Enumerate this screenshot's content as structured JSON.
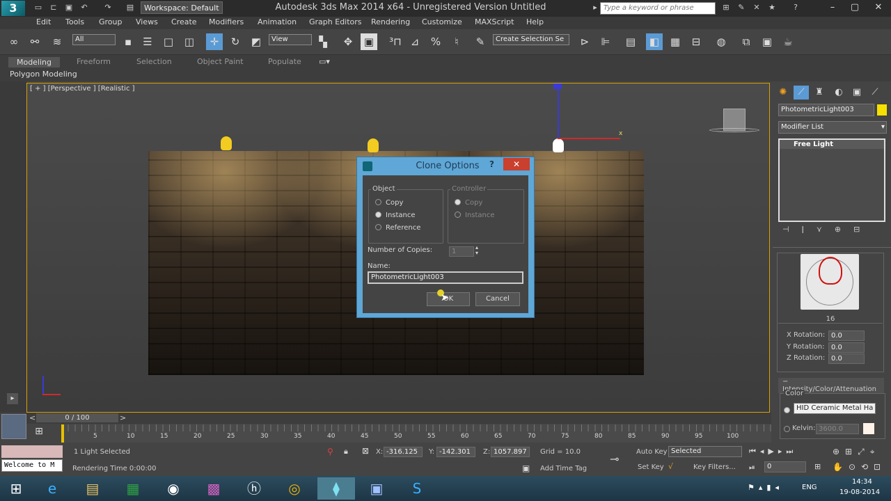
{
  "app": {
    "logo": "3",
    "title": "Autodesk 3ds Max  2014 x64  -  Unregistered Version    Untitled",
    "workspace": "Workspace: Default",
    "search_placeholder": "Type a keyword or phrase"
  },
  "menu": [
    "Edit",
    "Tools",
    "Group",
    "Views",
    "Create",
    "Modifiers",
    "Animation",
    "Graph Editors",
    "Rendering",
    "Customize",
    "MAXScript",
    "Help"
  ],
  "toolbar": {
    "filter_value": "All",
    "ref_coord_value": "View",
    "selection_set_placeholder": "Create Selection Se"
  },
  "ribbon": {
    "tabs": [
      "Modeling",
      "Freeform",
      "Selection",
      "Object Paint",
      "Populate"
    ],
    "sub_label": "Polygon Modeling"
  },
  "viewport": {
    "label": "[ + ] [Perspective ] [Realistic ]"
  },
  "command_panel": {
    "object_name": "PhotometricLight003",
    "modifier_list": "Modifier List",
    "stack_item": "Free Light",
    "web_value": "16",
    "x_rotation_label": "X Rotation:",
    "x_rotation": "0.0",
    "y_rotation_label": "Y Rotation:",
    "y_rotation": "0.0",
    "z_rotation_label": "Z Rotation:",
    "z_rotation": "0.0",
    "rollout_title": "Intensity/Color/Attenuation",
    "color_label": "Color",
    "color_preset": "HID Ceramic Metal Ha",
    "kelvin_label": "Kelvin:",
    "kelvin_value": "3600.0"
  },
  "dialog": {
    "title": "Clone Options",
    "help": "?",
    "object_group": "Object",
    "object_options": [
      "Copy",
      "Instance",
      "Reference"
    ],
    "object_selected": "Instance",
    "controller_group": "Controller",
    "controller_options": [
      "Copy",
      "Instance"
    ],
    "copies_label": "Number of Copies:",
    "copies_value": "1",
    "name_label": "Name:",
    "name_value": "PhotometricLight003",
    "ok_label": "OK",
    "cancel_label": "Cancel"
  },
  "timeline": {
    "frame_counter": "0 / 100",
    "ticks": [
      "5",
      "10",
      "15",
      "20",
      "25",
      "30",
      "35",
      "40",
      "45",
      "50",
      "55",
      "60",
      "65",
      "70",
      "75",
      "80",
      "85",
      "90",
      "95",
      "100"
    ]
  },
  "status": {
    "maxscript_text": "Welcome to M",
    "selection_info": "1 Light Selected",
    "render_time": "Rendering Time  0:00:00",
    "x_label": "X:",
    "x_value": "-316.125",
    "y_label": "Y:",
    "y_value": "-142.301",
    "z_label": "Z:",
    "z_value": "1057.897",
    "grid": "Grid = 10.0",
    "add_time_tag": "Add Time Tag",
    "auto_key": "Auto Key",
    "set_key": "Set Key",
    "key_mode": "Selected",
    "key_filters": "Key Filters...",
    "current_frame": "0"
  },
  "taskbar": {
    "tray_lang": "ENG",
    "time": "14:34",
    "date": "19-08-2014"
  }
}
